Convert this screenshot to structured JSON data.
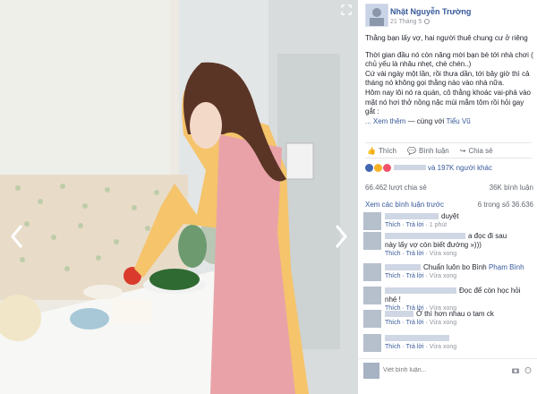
{
  "post": {
    "author": "Nhật Nguyễn Trường",
    "date": "21 Tháng 5",
    "body": [
      "Thằng bạn lấy vợ, hai người thuê chung cư ở riêng",
      "Thời gian đầu nó còn năng mời bạn bè tới nhà chơi ( chủ yếu là nhâu nhẹt, chè chén..)",
      "Cứ vài ngày một lần, rồi thưa dần, tới bây giờ thì cả tháng nó không gọi thằng nào vào nhà nữa.",
      "Hôm nay lôi nó ra quán, cô thằng khoác vai-phả vào mặt nó hơi thở nồng nặc mùi mắm tôm rồi hỏi gay gắt :"
    ],
    "see_more": "... Xem thêm",
    "with_prefix": " — cùng với ",
    "with_friend": "Tiểu Vũ"
  },
  "actions": {
    "like": "Thích",
    "comment": "Bình luận",
    "share": "Chia sẻ"
  },
  "reactions": {
    "others": "và 197K người khác",
    "shares": "66.462 lượt chia sẻ",
    "comments_count": "36K bình luận"
  },
  "comments_header": {
    "prev": "Xem các bình luận trước",
    "range": "6 trong số 36.636"
  },
  "comments": [
    {
      "text": "duyệt",
      "like": "Thích",
      "reply": "Trả lời",
      "time": "1 phút"
    },
    {
      "text": "a đọc đi sau",
      "text2": "này lấy vợ còn biết đường »)))",
      "like": "Thích",
      "reply": "Trả lời",
      "time": "Vừa xong"
    },
    {
      "text": "Chuẩn luôn bo Bình ",
      "tag": "Phạm Bình",
      "like": "Thích",
      "reply": "Trả lời",
      "time": "Vừa xong"
    },
    {
      "text": "Đọc để còn học hỏi nhé !",
      "like": "Thích",
      "reply": "Trả lời",
      "time": "Vừa xong"
    },
    {
      "text": "Ở thì hơn nhau o tam ck",
      "like": "Thích",
      "reply": "Trả lời",
      "time": "Vừa xong"
    },
    {
      "text": "",
      "like": "Thích",
      "reply": "Trả lời",
      "time": "Vừa xong"
    }
  ],
  "write_comment": {
    "placeholder": "Viết bình luận..."
  },
  "colors": {
    "link": "#365899",
    "muted": "#90949c",
    "like_blue": "#4267b2",
    "love_red": "#f25268"
  }
}
